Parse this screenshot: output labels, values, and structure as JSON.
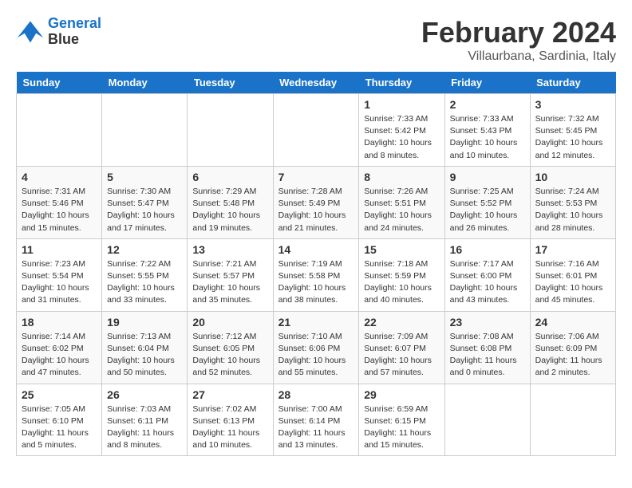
{
  "logo": {
    "line1": "General",
    "line2": "Blue"
  },
  "title": "February 2024",
  "subtitle": "Villaurbana, Sardinia, Italy",
  "headers": [
    "Sunday",
    "Monday",
    "Tuesday",
    "Wednesday",
    "Thursday",
    "Friday",
    "Saturday"
  ],
  "weeks": [
    [
      {
        "day": "",
        "info": ""
      },
      {
        "day": "",
        "info": ""
      },
      {
        "day": "",
        "info": ""
      },
      {
        "day": "",
        "info": ""
      },
      {
        "day": "1",
        "info": "Sunrise: 7:33 AM\nSunset: 5:42 PM\nDaylight: 10 hours\nand 8 minutes."
      },
      {
        "day": "2",
        "info": "Sunrise: 7:33 AM\nSunset: 5:43 PM\nDaylight: 10 hours\nand 10 minutes."
      },
      {
        "day": "3",
        "info": "Sunrise: 7:32 AM\nSunset: 5:45 PM\nDaylight: 10 hours\nand 12 minutes."
      }
    ],
    [
      {
        "day": "4",
        "info": "Sunrise: 7:31 AM\nSunset: 5:46 PM\nDaylight: 10 hours\nand 15 minutes."
      },
      {
        "day": "5",
        "info": "Sunrise: 7:30 AM\nSunset: 5:47 PM\nDaylight: 10 hours\nand 17 minutes."
      },
      {
        "day": "6",
        "info": "Sunrise: 7:29 AM\nSunset: 5:48 PM\nDaylight: 10 hours\nand 19 minutes."
      },
      {
        "day": "7",
        "info": "Sunrise: 7:28 AM\nSunset: 5:49 PM\nDaylight: 10 hours\nand 21 minutes."
      },
      {
        "day": "8",
        "info": "Sunrise: 7:26 AM\nSunset: 5:51 PM\nDaylight: 10 hours\nand 24 minutes."
      },
      {
        "day": "9",
        "info": "Sunrise: 7:25 AM\nSunset: 5:52 PM\nDaylight: 10 hours\nand 26 minutes."
      },
      {
        "day": "10",
        "info": "Sunrise: 7:24 AM\nSunset: 5:53 PM\nDaylight: 10 hours\nand 28 minutes."
      }
    ],
    [
      {
        "day": "11",
        "info": "Sunrise: 7:23 AM\nSunset: 5:54 PM\nDaylight: 10 hours\nand 31 minutes."
      },
      {
        "day": "12",
        "info": "Sunrise: 7:22 AM\nSunset: 5:55 PM\nDaylight: 10 hours\nand 33 minutes."
      },
      {
        "day": "13",
        "info": "Sunrise: 7:21 AM\nSunset: 5:57 PM\nDaylight: 10 hours\nand 35 minutes."
      },
      {
        "day": "14",
        "info": "Sunrise: 7:19 AM\nSunset: 5:58 PM\nDaylight: 10 hours\nand 38 minutes."
      },
      {
        "day": "15",
        "info": "Sunrise: 7:18 AM\nSunset: 5:59 PM\nDaylight: 10 hours\nand 40 minutes."
      },
      {
        "day": "16",
        "info": "Sunrise: 7:17 AM\nSunset: 6:00 PM\nDaylight: 10 hours\nand 43 minutes."
      },
      {
        "day": "17",
        "info": "Sunrise: 7:16 AM\nSunset: 6:01 PM\nDaylight: 10 hours\nand 45 minutes."
      }
    ],
    [
      {
        "day": "18",
        "info": "Sunrise: 7:14 AM\nSunset: 6:02 PM\nDaylight: 10 hours\nand 47 minutes."
      },
      {
        "day": "19",
        "info": "Sunrise: 7:13 AM\nSunset: 6:04 PM\nDaylight: 10 hours\nand 50 minutes."
      },
      {
        "day": "20",
        "info": "Sunrise: 7:12 AM\nSunset: 6:05 PM\nDaylight: 10 hours\nand 52 minutes."
      },
      {
        "day": "21",
        "info": "Sunrise: 7:10 AM\nSunset: 6:06 PM\nDaylight: 10 hours\nand 55 minutes."
      },
      {
        "day": "22",
        "info": "Sunrise: 7:09 AM\nSunset: 6:07 PM\nDaylight: 10 hours\nand 57 minutes."
      },
      {
        "day": "23",
        "info": "Sunrise: 7:08 AM\nSunset: 6:08 PM\nDaylight: 11 hours\nand 0 minutes."
      },
      {
        "day": "24",
        "info": "Sunrise: 7:06 AM\nSunset: 6:09 PM\nDaylight: 11 hours\nand 2 minutes."
      }
    ],
    [
      {
        "day": "25",
        "info": "Sunrise: 7:05 AM\nSunset: 6:10 PM\nDaylight: 11 hours\nand 5 minutes."
      },
      {
        "day": "26",
        "info": "Sunrise: 7:03 AM\nSunset: 6:11 PM\nDaylight: 11 hours\nand 8 minutes."
      },
      {
        "day": "27",
        "info": "Sunrise: 7:02 AM\nSunset: 6:13 PM\nDaylight: 11 hours\nand 10 minutes."
      },
      {
        "day": "28",
        "info": "Sunrise: 7:00 AM\nSunset: 6:14 PM\nDaylight: 11 hours\nand 13 minutes."
      },
      {
        "day": "29",
        "info": "Sunrise: 6:59 AM\nSunset: 6:15 PM\nDaylight: 11 hours\nand 15 minutes."
      },
      {
        "day": "",
        "info": ""
      },
      {
        "day": "",
        "info": ""
      }
    ]
  ]
}
